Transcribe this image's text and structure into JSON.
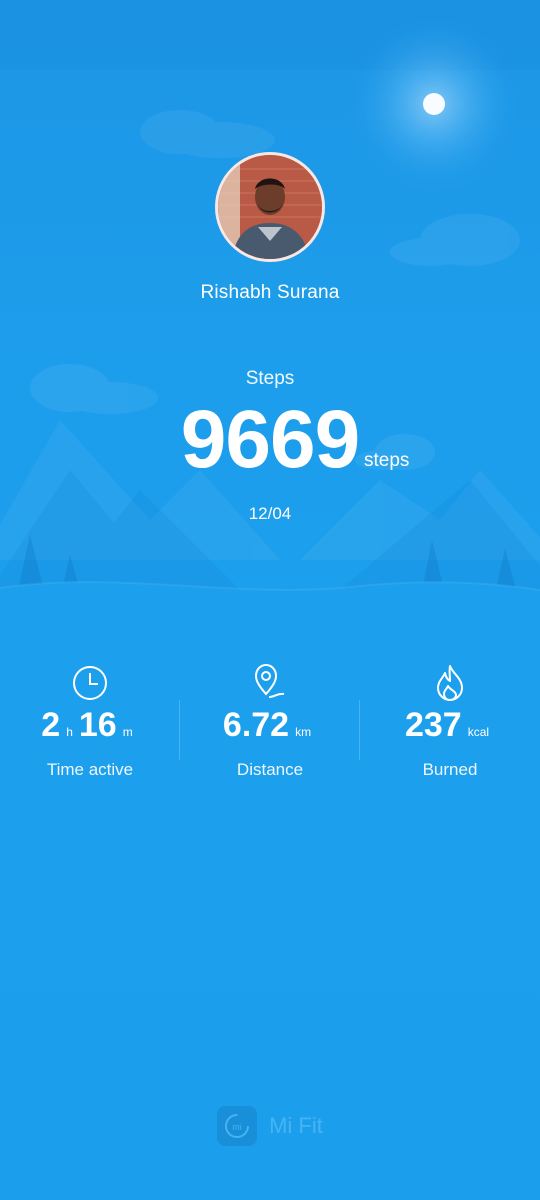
{
  "user": {
    "name": "Rishabh Surana"
  },
  "steps": {
    "label": "Steps",
    "value": "9669",
    "unit": "steps",
    "date": "12/04"
  },
  "stats": {
    "time_active": {
      "hours": "2",
      "hours_unit": "h",
      "minutes": "16",
      "minutes_unit": "m",
      "label": "Time active",
      "icon": "clock-icon"
    },
    "distance": {
      "value": "6.72",
      "unit": "km",
      "label": "Distance",
      "icon": "location-pin-icon"
    },
    "burned": {
      "value": "237",
      "unit": "kcal",
      "label": "Burned",
      "icon": "flame-icon"
    }
  },
  "brand": {
    "name": "Mi Fit",
    "logo_text": "mi"
  },
  "colors": {
    "background": "#1b9fec",
    "text": "#ffffff"
  }
}
